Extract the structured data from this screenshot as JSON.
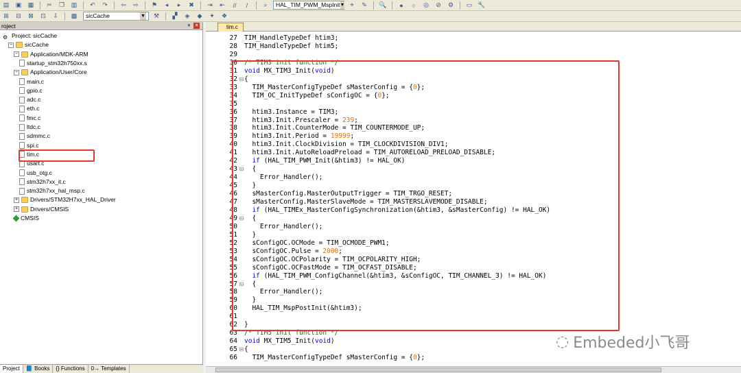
{
  "toolbar1": {
    "function_combo": "HAL_TIM_PWM_MspInit"
  },
  "toolbar2": {
    "target_combo": "sicCache"
  },
  "project_panel": {
    "title": "roject",
    "tree": [
      {
        "label": "Project: sicCache",
        "indent": 0,
        "type": "root"
      },
      {
        "label": "sicCache",
        "indent": 1,
        "type": "target"
      },
      {
        "label": "Application/MDK-ARM",
        "indent": 2,
        "type": "folder"
      },
      {
        "label": "startup_stm32h750xx.s",
        "indent": 3,
        "type": "file"
      },
      {
        "label": "Application/User/Core",
        "indent": 2,
        "type": "folder"
      },
      {
        "label": "main.c",
        "indent": 3,
        "type": "file"
      },
      {
        "label": "gpio.c",
        "indent": 3,
        "type": "file"
      },
      {
        "label": "adc.c",
        "indent": 3,
        "type": "file"
      },
      {
        "label": "eth.c",
        "indent": 3,
        "type": "file"
      },
      {
        "label": "fmc.c",
        "indent": 3,
        "type": "file"
      },
      {
        "label": "ltdc.c",
        "indent": 3,
        "type": "file"
      },
      {
        "label": "sdmmc.c",
        "indent": 3,
        "type": "file"
      },
      {
        "label": "spi.c",
        "indent": 3,
        "type": "file"
      },
      {
        "label": "tim.c",
        "indent": 3,
        "type": "file"
      },
      {
        "label": "usart.c",
        "indent": 3,
        "type": "file"
      },
      {
        "label": "usb_otg.c",
        "indent": 3,
        "type": "file"
      },
      {
        "label": "stm32h7xx_it.c",
        "indent": 3,
        "type": "file"
      },
      {
        "label": "stm32h7xx_hal_msp.c",
        "indent": 3,
        "type": "file"
      },
      {
        "label": "Drivers/STM32H7xx_HAL_Driver",
        "indent": 2,
        "type": "folder"
      },
      {
        "label": "Drivers/CMSIS",
        "indent": 2,
        "type": "folder"
      },
      {
        "label": "CMSIS",
        "indent": 2,
        "type": "cmsis"
      }
    ],
    "tabs": [
      "Project",
      "Books",
      "Functions",
      "Templates"
    ]
  },
  "editor": {
    "tab": "tim.c",
    "lines": [
      {
        "n": "27",
        "t": "TIM_HandleTypeDef htim3;"
      },
      {
        "n": "28",
        "t": "TIM_HandleTypeDef htim5;"
      },
      {
        "n": "29",
        "t": ""
      },
      {
        "n": "30",
        "t": "/* TIM3 init function */",
        "c": "cm"
      },
      {
        "n": "31",
        "t": "void MX_TIM3_Init(void)"
      },
      {
        "n": "32",
        "t": "{"
      },
      {
        "n": "33",
        "t": "  TIM_MasterConfigTypeDef sMasterConfig = {0};"
      },
      {
        "n": "34",
        "t": "  TIM_OC_InitTypeDef sConfigOC = {0};"
      },
      {
        "n": "35",
        "t": ""
      },
      {
        "n": "36",
        "t": "  htim3.Instance = TIM3;"
      },
      {
        "n": "37",
        "t": "  htim3.Init.Prescaler = 239;"
      },
      {
        "n": "38",
        "t": "  htim3.Init.CounterMode = TIM_COUNTERMODE_UP;"
      },
      {
        "n": "39",
        "t": "  htim3.Init.Period = 19999;"
      },
      {
        "n": "40",
        "t": "  htim3.Init.ClockDivision = TIM_CLOCKDIVISION_DIV1;"
      },
      {
        "n": "41",
        "t": "  htim3.Init.AutoReloadPreload = TIM_AUTORELOAD_PRELOAD_DISABLE;"
      },
      {
        "n": "42",
        "t": "  if (HAL_TIM_PWM_Init(&htim3) != HAL_OK)"
      },
      {
        "n": "43",
        "t": "  {"
      },
      {
        "n": "44",
        "t": "    Error_Handler();"
      },
      {
        "n": "45",
        "t": "  }"
      },
      {
        "n": "46",
        "t": "  sMasterConfig.MasterOutputTrigger = TIM_TRGO_RESET;"
      },
      {
        "n": "47",
        "t": "  sMasterConfig.MasterSlaveMode = TIM_MASTERSLAVEMODE_DISABLE;"
      },
      {
        "n": "48",
        "t": "  if (HAL_TIMEx_MasterConfigSynchronization(&htim3, &sMasterConfig) != HAL_OK)"
      },
      {
        "n": "49",
        "t": "  {"
      },
      {
        "n": "50",
        "t": "    Error_Handler();"
      },
      {
        "n": "51",
        "t": "  }"
      },
      {
        "n": "52",
        "t": "  sConfigOC.OCMode = TIM_OCMODE_PWM1;"
      },
      {
        "n": "53",
        "t": "  sConfigOC.Pulse = 2000;"
      },
      {
        "n": "54",
        "t": "  sConfigOC.OCPolarity = TIM_OCPOLARITY_HIGH;"
      },
      {
        "n": "55",
        "t": "  sConfigOC.OCFastMode = TIM_OCFAST_DISABLE;"
      },
      {
        "n": "56",
        "t": "  if (HAL_TIM_PWM_ConfigChannel(&htim3, &sConfigOC, TIM_CHANNEL_3) != HAL_OK)"
      },
      {
        "n": "57",
        "t": "  {"
      },
      {
        "n": "58",
        "t": "    Error_Handler();"
      },
      {
        "n": "59",
        "t": "  }"
      },
      {
        "n": "60",
        "t": "  HAL_TIM_MspPostInit(&htim3);"
      },
      {
        "n": "61",
        "t": ""
      },
      {
        "n": "62",
        "t": "}"
      },
      {
        "n": "63",
        "t": "/* TIM5 init function */",
        "c": "cm"
      },
      {
        "n": "64",
        "t": "void MX_TIM5_Init(void)"
      },
      {
        "n": "65",
        "t": "{"
      },
      {
        "n": "66",
        "t": "  TIM_MasterConfigTypeDef sMasterConfig = {0};"
      }
    ]
  },
  "watermark": "Embeded小飞哥",
  "colors": {
    "highlight": "#e8342a",
    "keyword": "#0000ff",
    "comment": "#008000",
    "number": "#e07000"
  }
}
